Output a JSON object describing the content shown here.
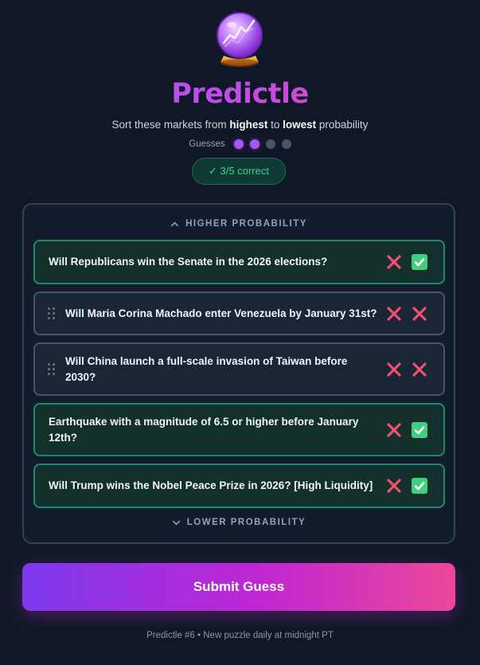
{
  "app": {
    "title": "Predictle",
    "subtitle_pre": "Sort these markets from ",
    "subtitle_high": "highest",
    "subtitle_mid": " to ",
    "subtitle_low": "lowest",
    "subtitle_post": " probability",
    "logo_icon": "crystal-ball-icon"
  },
  "guesses": {
    "label": "Guesses",
    "used": 2,
    "total": 4
  },
  "result": {
    "label": "✓ 3/5 correct",
    "color": "#34d399"
  },
  "board": {
    "top_label": "HIGHER PROBABILITY",
    "bottom_label": "LOWER PROBABILITY",
    "items": [
      {
        "text": "Will Republicans win the Senate in the 2026 elections?",
        "correct": true,
        "draggable": false,
        "marks": [
          "x",
          "check"
        ]
      },
      {
        "text": "Will Maria Corina Machado enter Venezuela by January 31st?",
        "correct": false,
        "draggable": true,
        "marks": [
          "x",
          "x"
        ]
      },
      {
        "text": "Will China launch a full-scale invasion of Taiwan before 2030?",
        "correct": false,
        "draggable": true,
        "marks": [
          "x",
          "x"
        ]
      },
      {
        "text": "Earthquake with a magnitude of 6.5 or higher before January 12th?",
        "correct": true,
        "draggable": false,
        "marks": [
          "x",
          "check"
        ]
      },
      {
        "text": "Will Trump wins the Nobel Peace Prize in 2026? [High Liquidity]",
        "correct": true,
        "draggable": false,
        "marks": [
          "x",
          "check"
        ]
      }
    ]
  },
  "submit": {
    "label": "Submit Guess"
  },
  "footer": {
    "text": "Predictle #6 • New puzzle daily at midnight PT"
  },
  "colors": {
    "background": "#101827",
    "accent_purple": "#a855f7",
    "accent_pink": "#ec4899",
    "correct_border": "#1f8a6b",
    "wrong_mark": "#f0506e",
    "check_mark": "#3fcf7f"
  }
}
